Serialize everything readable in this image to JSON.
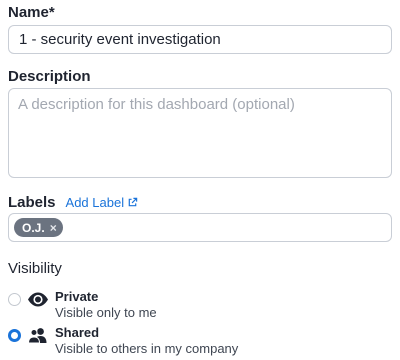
{
  "form": {
    "name": {
      "label": "Name",
      "required_mark": "*",
      "value": "1 - security event investigation"
    },
    "description": {
      "label": "Description",
      "value": "",
      "placeholder": "A description for this dashboard (optional)"
    },
    "labels": {
      "label": "Labels",
      "add_link": "Add Label",
      "add_link_icon": "external-link-icon",
      "chips": [
        {
          "text": "O.J.",
          "remove_glyph": "×"
        }
      ]
    },
    "visibility": {
      "label": "Visibility",
      "options": [
        {
          "title": "Private",
          "description": "Visible only to me",
          "icon": "eye-icon",
          "selected": false
        },
        {
          "title": "Shared",
          "description": "Visible to others in my company",
          "icon": "users-icon",
          "selected": true
        }
      ]
    }
  },
  "colors": {
    "accent": "#1a73d9",
    "chip_bg": "#6b7380",
    "border": "#c9ced6",
    "text": "#1f2430",
    "placeholder": "#a3a8b1"
  }
}
